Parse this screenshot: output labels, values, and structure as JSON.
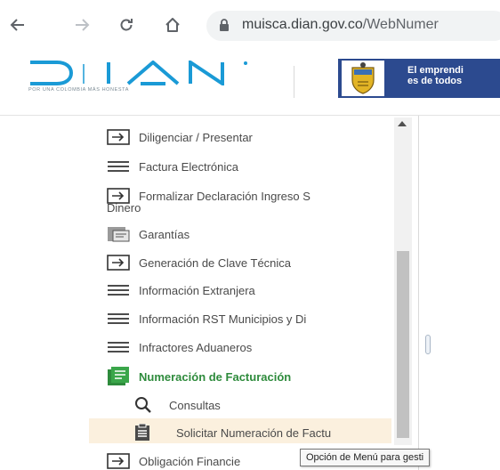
{
  "browser": {
    "url_host": "muisca.dian.gov.co",
    "url_path": "/WebNumer"
  },
  "header": {
    "logo_text": "DIAN",
    "logo_tagline": "POR UNA COLOMBIA MÁS HONESTA",
    "banner_line1": "El emprendi",
    "banner_line2": "es de todos"
  },
  "menu": {
    "items": [
      {
        "label": "Diligenciar / Presentar",
        "icon": "form-icon"
      },
      {
        "label": "Factura Electrónica",
        "icon": "list-icon"
      },
      {
        "label": "Formalizar Declaración Ingreso S",
        "label_cont": "Dinero",
        "icon": "form-icon"
      },
      {
        "label": "Garantías",
        "icon": "document-icon"
      },
      {
        "label": "Generación de Clave Técnica",
        "icon": "form-icon"
      },
      {
        "label": "Información Extranjera",
        "icon": "list-icon"
      },
      {
        "label": "Información RST Municipios y Di",
        "icon": "list-icon"
      },
      {
        "label": "Infractores Aduaneros",
        "icon": "list-icon"
      },
      {
        "label": "Numeración de Facturación",
        "icon": "book-icon"
      },
      {
        "label": "Consultas",
        "icon": "search-icon"
      },
      {
        "label": "Solicitar Numeración de Factu",
        "icon": "document-icon"
      },
      {
        "label": "Obligación Financie",
        "icon": "form-icon"
      }
    ]
  },
  "tooltip": {
    "text": "Opción de Menú para gesti"
  },
  "colors": {
    "active_green": "#2e8b3c",
    "highlight": "#fbf0de",
    "banner_blue": "#2c4a8f",
    "logo_blue": "#1a9ad6"
  }
}
